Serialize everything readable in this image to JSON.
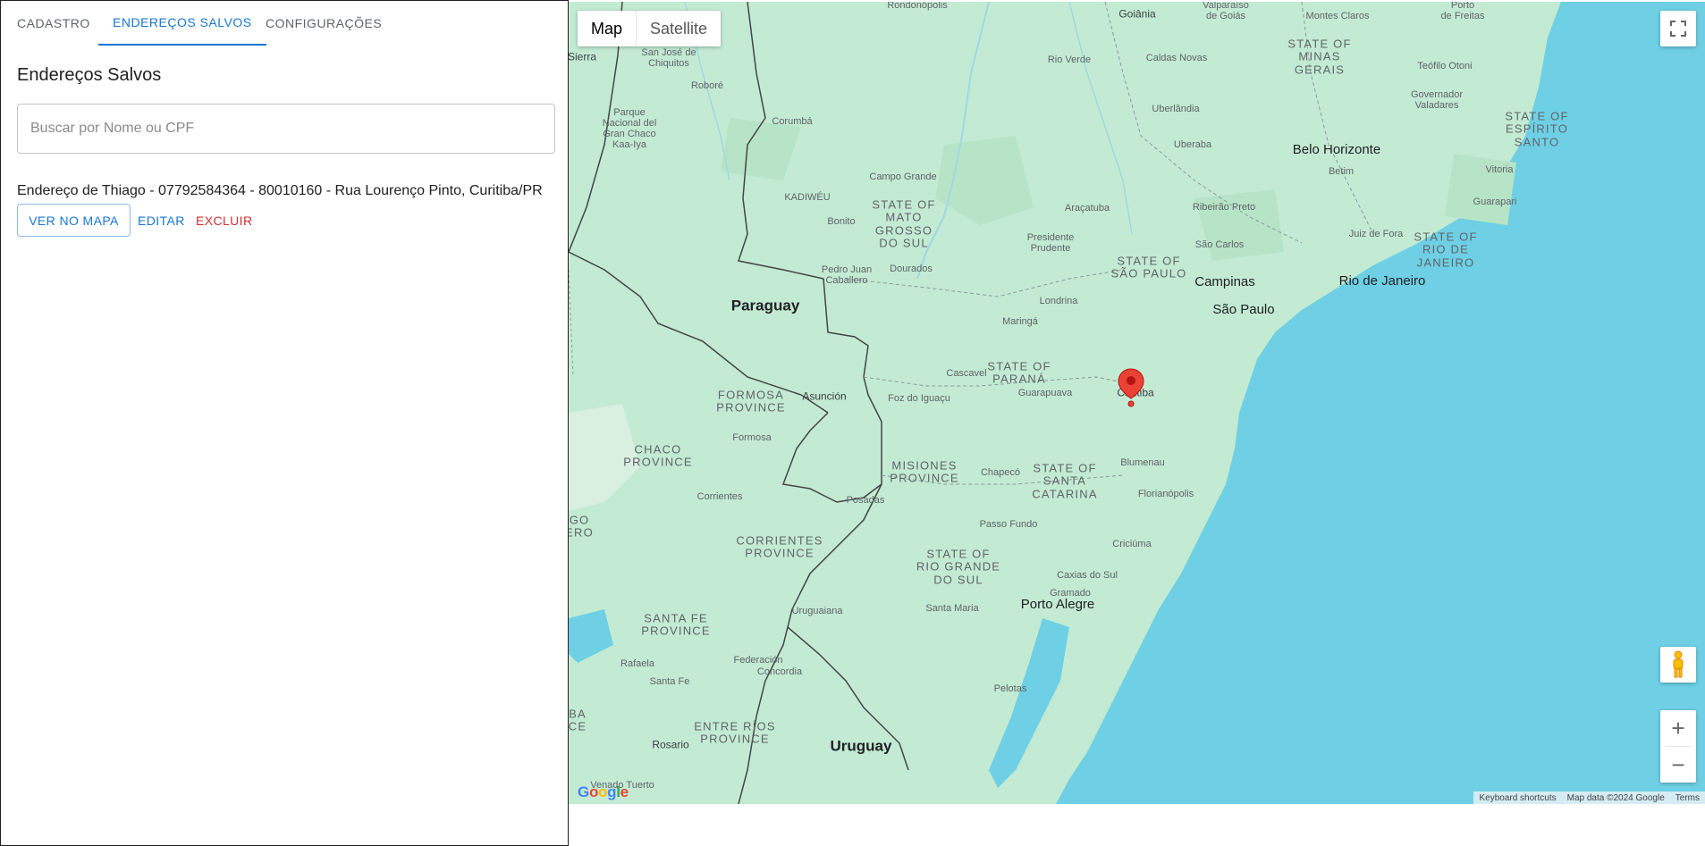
{
  "tabs": [
    {
      "label": "CADASTRO"
    },
    {
      "label": "ENDEREÇOS SALVOS"
    },
    {
      "label": "CONFIGURAÇÕES"
    }
  ],
  "page_title": "Endereços Salvos",
  "search": {
    "placeholder": "Buscar por Nome ou CPF",
    "value": ""
  },
  "addresses": [
    {
      "text": "Endereço de Thiago - 07792584364 - 80010160 - Rua Lourenço Pinto, Curitiba/PR",
      "view_label": "VER NO MAPA",
      "edit_label": "EDITAR",
      "delete_label": "EXCLUIR"
    }
  ],
  "map": {
    "type_map": "Map",
    "type_satellite": "Satellite",
    "keyboard_shortcuts": "Keyboard shortcuts",
    "map_data": "Map data ©2024 Google",
    "terms": "Terms",
    "logo": "Google",
    "zoom_in": "+",
    "zoom_out": "−",
    "marker_label": "Curitiba",
    "labels": {
      "goiania": "Goiânia",
      "montes_claros": "Montes Claros",
      "minas_gerais": "STATE OF\nMINAS\nGERAIS",
      "rio_verde": "Rio Verde",
      "caldas_novas": "Caldas Novas",
      "teofilo_otoni": "Teófilo Otoni",
      "governador_valadares": "Governador\nValadares",
      "espirito_santo": "STATE OF\nESPÍRITO\nSANTO",
      "uberlandia": "Uberlândia",
      "uberaba": "Uberaba",
      "belo_horizonte": "Belo Horizonte",
      "betim": "Betim",
      "vitoria": "Vitoria",
      "guarapari": "Guarapari",
      "san_jose_chiquitos": "San José de\nChiquitos",
      "robore": "Roboré",
      "corumba": "Corumbá",
      "parque_gran_chaco": "Parque\nNacional del\nGran Chaco\nKaa-Iya",
      "campo_grande": "Campo Grande",
      "kadiweu": "KADIWÉU",
      "bonito": "Bonito",
      "mato_grosso_sul": "STATE OF\nMATO\nGROSSO\nDO SUL",
      "aracatuba": "Araçatuba",
      "ribeirao_preto": "Ribeirão Preto",
      "juiz_de_fora": "Juiz de Fora",
      "rio_de_janeiro_state": "STATE OF\nRIO DE\nJANEIRO",
      "presidente_prudente": "Presidente\nPrudente",
      "sao_carlos": "São Carlos",
      "sao_paulo_state": "STATE OF\nSÃO PAULO",
      "campinas": "Campinas",
      "rio_de_janeiro": "Rio de Janeiro",
      "sao_paulo": "São Paulo",
      "dourados": "Dourados",
      "pedro_juan": "Pedro Juan\nCaballero",
      "paraguay": "Paraguay",
      "londrina": "Londrina",
      "maringa": "Maringá",
      "cascavel": "Cascavel",
      "parana": "STATE OF\nPARANÁ",
      "guarapuava": "Guarapuava",
      "curitiba": "Curitiba",
      "formosa_province": "FORMOSA\nPROVINCE",
      "asuncion": "Asunción",
      "foz": "Foz do Iguaçu",
      "formosa": "Formosa",
      "chaco_province": "CHACO\nPROVINCE",
      "misiones": "MISIONES\nPROVINCE",
      "chapeco": "Chapecó",
      "santa_catarina": "STATE OF\nSANTA\nCATARINA",
      "blumenau": "Blumenau",
      "florianopolis": "Florianópolis",
      "corrientes": "Corrientes",
      "posadas": "Posadas",
      "passo_fundo": "Passo Fundo",
      "criciuma": "Criciúma",
      "corrientes_province": "CORRIENTES\nPROVINCE",
      "rio_grande_sul": "STATE OF\nRIO GRANDE\nDO SUL",
      "caxias": "Caxias do Sul",
      "gramado": "Gramado",
      "santa_maria": "Santa Maria",
      "porto_alegre": "Porto Alegre",
      "uruguaiana": "Uruguaiana",
      "santa_fe_province": "SANTA FE\nPROVINCE",
      "rafaela": "Rafaela",
      "federacion": "Federación",
      "concordia": "Concordia",
      "santa_fe": "Santa Fe",
      "pelotas": "Pelotas",
      "entre_rios": "ENTRE RÍOS\nPROVINCE",
      "rosario": "Rosario",
      "uruguay": "Uruguay",
      "venado_tuerto": "Venado Tuerto",
      "sierra": "Sierra",
      "cordoba_frag": "BA\nCE",
      "sgo_frag": "GO\nERO",
      "frontera_frag": "Rondonópolis",
      "valparaiso": "Valparaíso\nde Goiás",
      "porto_frag": "Porto\nde Freitas"
    }
  }
}
